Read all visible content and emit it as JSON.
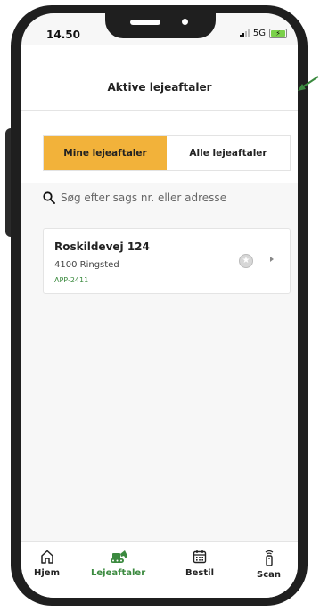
{
  "status": {
    "time": "14.50",
    "network": "5G"
  },
  "header": {
    "title": "Aktive lejeaftaler"
  },
  "segments": [
    {
      "label": "Mine lejeaftaler",
      "active": true
    },
    {
      "label": "Alle lejeaftaler",
      "active": false
    }
  ],
  "search": {
    "placeholder": "Søg efter sags nr. eller adresse"
  },
  "agreements": [
    {
      "title": "Roskildevej 124",
      "city": "4100 Ringsted",
      "code": "APP-2411"
    }
  ],
  "tabs": [
    {
      "label": "Hjem",
      "icon": "home-icon",
      "active": false
    },
    {
      "label": "Lejeaftaler",
      "icon": "excavator-icon",
      "active": true
    },
    {
      "label": "Bestil",
      "icon": "calendar-icon",
      "active": false
    },
    {
      "label": "Scan",
      "icon": "scanner-icon",
      "active": false
    }
  ],
  "colors": {
    "accent": "#F2B23A",
    "brand_green": "#3B8A3F",
    "frame": "#1F1F1F"
  }
}
